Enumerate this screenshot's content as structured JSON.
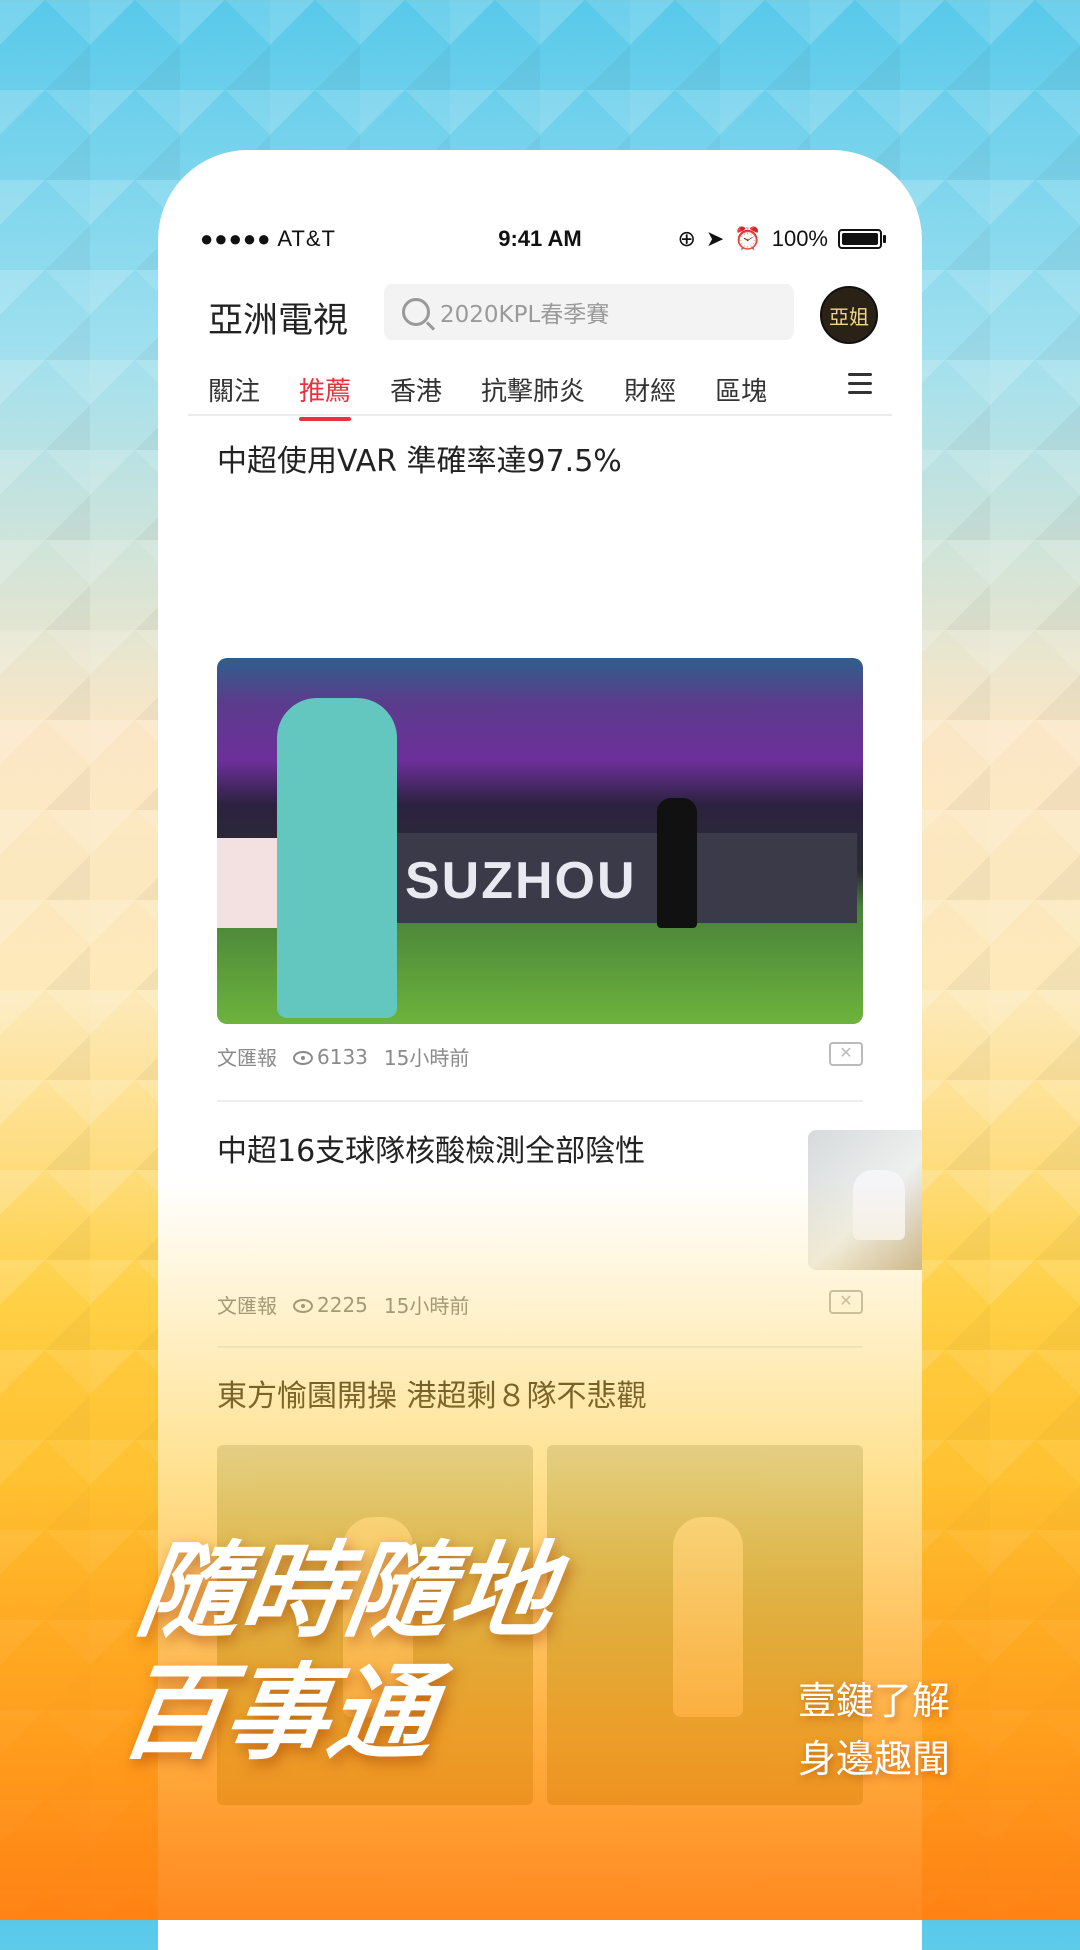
{
  "status_bar": {
    "carrier": "●●●●● AT&T",
    "time": "9:41 AM",
    "battery": "100%"
  },
  "header": {
    "app_title": "亞洲電視",
    "search_placeholder": "2020KPL春季賽",
    "avatar_text": "亞姐"
  },
  "tabs": [
    {
      "label": "關注"
    },
    {
      "label": "推薦",
      "active": true
    },
    {
      "label": "香港"
    },
    {
      "label": "抗擊肺炎"
    },
    {
      "label": "財經"
    },
    {
      "label": "區塊"
    }
  ],
  "articles": [
    {
      "title": "中超使用VAR  準確率達97.5%",
      "source": "文匯報",
      "views": "6133",
      "time": "15小時前",
      "image_text": "SUZHOU"
    },
    {
      "title": "中超16支球隊核酸檢測全部陰性",
      "source": "文匯報",
      "views": "2225",
      "time": "15小時前"
    },
    {
      "title": "東方愉園開操  港超剩８隊不悲觀"
    }
  ],
  "promo": {
    "slogan_line1": "隨時隨地",
    "slogan_line2": "百事通",
    "sub_line1": "壹鍵了解",
    "sub_line2": "身邊趣聞"
  },
  "colors": {
    "accent": "#e6333c"
  }
}
